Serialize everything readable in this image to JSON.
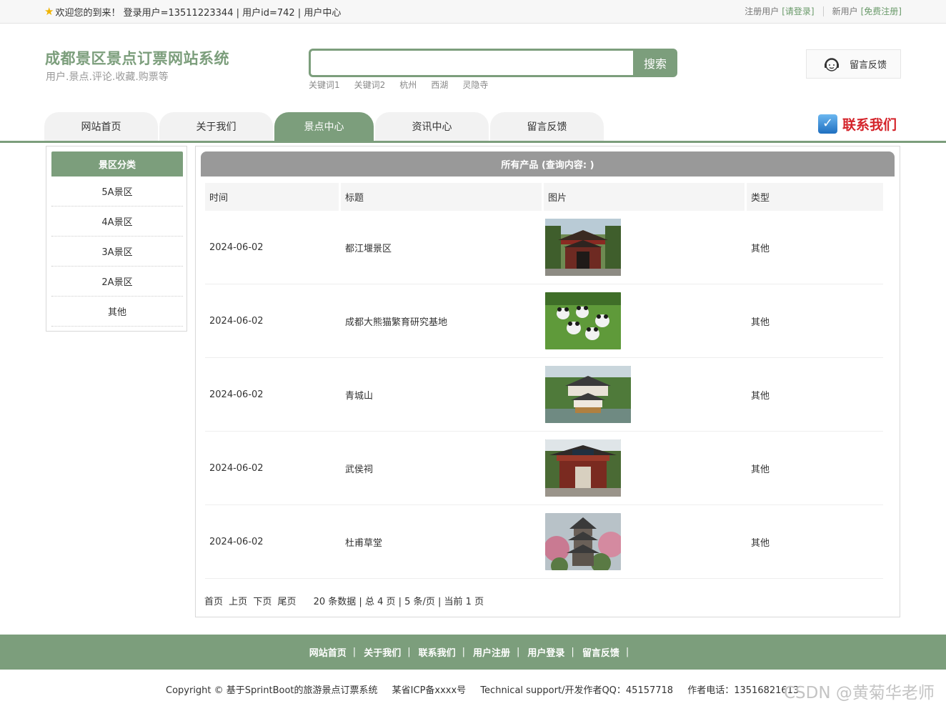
{
  "topbar": {
    "welcome": "欢迎您的到来！ 登录用户=13511223344 | 用户id=742 | 用户中心",
    "register_user": "注册用户",
    "login_link": "[请登录]",
    "new_user": "新用户",
    "free_register": "[免费注册]"
  },
  "header": {
    "title": "成都景区景点订票网站系统",
    "subtitle": "用户.景点.评论.收藏.购票等",
    "search_value": "",
    "search_button": "搜索",
    "keywords": [
      "关键词1",
      "关键词2",
      "杭州",
      "西湖",
      "灵隐寺"
    ],
    "feedback": "留言反馈"
  },
  "nav": {
    "items": [
      "网站首页",
      "关于我们",
      "景点中心",
      "资讯中心",
      "留言反馈"
    ],
    "contact": "联系我们"
  },
  "sidebar": {
    "title": "景区分类",
    "items": [
      "5A景区",
      "4A景区",
      "3A景区",
      "2A景区",
      "其他"
    ]
  },
  "main": {
    "title": "所有产品 (查询内容: )",
    "columns": [
      "时间",
      "标题",
      "图片",
      "类型"
    ],
    "rows": [
      {
        "time": "2024-06-02",
        "title": "都江堰景区",
        "type": "其他",
        "image": "temple-gate"
      },
      {
        "time": "2024-06-02",
        "title": "成都大熊猫繁育研究基地",
        "type": "其他",
        "image": "pandas"
      },
      {
        "time": "2024-06-02",
        "title": "青城山",
        "type": "其他",
        "image": "mountain-temple"
      },
      {
        "time": "2024-06-02",
        "title": "武侯祠",
        "type": "其他",
        "image": "shrine-gate"
      },
      {
        "time": "2024-06-02",
        "title": "杜甫草堂",
        "type": "其他",
        "image": "pagoda"
      }
    ],
    "pager": {
      "first": "首页",
      "prev": "上页",
      "next": "下页",
      "last": "尾页",
      "info": "20 条数据 | 总 4 页 | 5 条/页 | 当前 1 页"
    }
  },
  "footer": {
    "links": [
      "网站首页",
      "关于我们",
      "联系我们",
      "用户注册",
      "用户登录",
      "留言反馈"
    ],
    "copyright": "Copyright © 基于SprintBoot的旅游景点订票系统",
    "icp": "某省ICP备xxxx号",
    "support": "Technical support/开发作者QQ：45157718",
    "phone": "作者电话：13516821613",
    "watermark": "CSDN @黄菊华老师"
  },
  "colors": {
    "accent": "#7c9e7c",
    "header_gray": "#999999",
    "contact_red": "#d4232a"
  }
}
